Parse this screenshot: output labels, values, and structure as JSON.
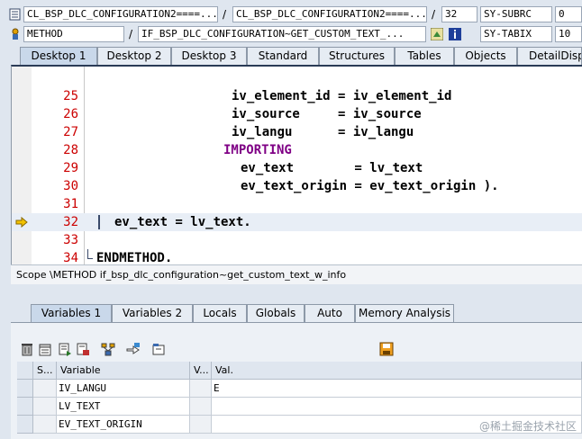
{
  "header": {
    "row1": {
      "program_field": "CL_BSP_DLC_CONFIGURATION2====...",
      "class_field": "CL_BSP_DLC_CONFIGURATION2====...",
      "line_field": "32",
      "var_name": "SY-SUBRC",
      "var_value": "0"
    },
    "row2": {
      "type_field": "METHOD",
      "method_field": "IF_BSP_DLC_CONFIGURATION~GET_CUSTOM_TEXT_...",
      "var_name": "SY-TABIX",
      "var_value": "10"
    }
  },
  "desktop_tabs": [
    "Desktop 1",
    "Desktop 2",
    "Desktop 3",
    "Standard",
    "Structures",
    "Tables",
    "Objects",
    "DetailDisplay"
  ],
  "code_lines": [
    {
      "n": "25",
      "text": "iv_element_id = iv_element_id"
    },
    {
      "n": "26",
      "text": "iv_source     = iv_source"
    },
    {
      "n": "27",
      "text": "iv_langu      = iv_langu"
    },
    {
      "n": "28",
      "text": "IMPORTING"
    },
    {
      "n": "29",
      "text": "ev_text        = lv_text"
    },
    {
      "n": "30",
      "text": "ev_text_origin = ev_text_origin )."
    },
    {
      "n": "31",
      "text": ""
    },
    {
      "n": "32",
      "text": "ev_text = lv_text."
    },
    {
      "n": "33",
      "text": ""
    },
    {
      "n": "34",
      "text": "ENDMETHOD."
    }
  ],
  "scope_text": "Scope \\METHOD if_bsp_dlc_configuration~get_custom_text_w_info",
  "variable_tabs": [
    "Variables 1",
    "Variables 2",
    "Locals",
    "Globals",
    "Auto",
    "Memory Analysis"
  ],
  "grid": {
    "headers": {
      "s": "S...",
      "variable": "Variable",
      "v": "V...",
      "val": "Val."
    },
    "rows": [
      {
        "variable": "IV_LANGU",
        "val": "E"
      },
      {
        "variable": "LV_TEXT",
        "val": ""
      },
      {
        "variable": "EV_TEXT_ORIGIN",
        "val": ""
      }
    ]
  },
  "watermark": "@稀土掘金技术社区",
  "colors": {
    "line_number": "#cc0000",
    "keyword": "#7f0085",
    "current_line": "#e8eef6"
  }
}
